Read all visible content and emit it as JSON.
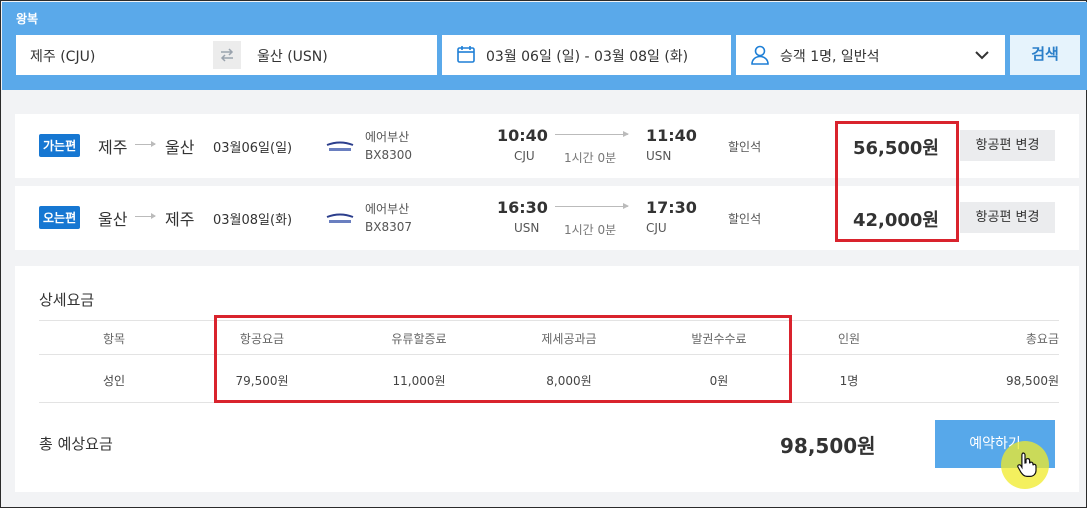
{
  "search": {
    "trip_type": "왕복",
    "from": "제주 (CJU)",
    "to": "울산 (USN)",
    "dates": "03월 06일 (일)  -  03월 08일 (화)",
    "passengers": "승객 1명, 일반석",
    "search_label": "검색"
  },
  "flights": [
    {
      "badge": "가는편",
      "from_city": "제주",
      "to_city": "울산",
      "date": "03월06일(일)",
      "airline": "에어부산",
      "flight_no": "BX8300",
      "dep_time": "10:40",
      "dep_code": "CJU",
      "duration": "1시간 0분",
      "arr_time": "11:40",
      "arr_code": "USN",
      "seat_class": "할인석",
      "fare": "56,500원",
      "change_label": "항공편 변경"
    },
    {
      "badge": "오는편",
      "from_city": "울산",
      "to_city": "제주",
      "date": "03월08일(화)",
      "airline": "에어부산",
      "flight_no": "BX8307",
      "dep_time": "16:30",
      "dep_code": "USN",
      "duration": "1시간 0분",
      "arr_time": "17:30",
      "arr_code": "CJU",
      "seat_class": "할인석",
      "fare": "42,000원",
      "change_label": "항공편 변경"
    }
  ],
  "details": {
    "title": "상세요금",
    "headers": [
      "항목",
      "항공요금",
      "유류할증료",
      "제세공과금",
      "발권수수료",
      "인원",
      "총요금"
    ],
    "rows": [
      [
        "성인",
        "79,500원",
        "11,000원",
        "8,000원",
        "0원",
        "1명",
        "98,500원"
      ]
    ],
    "total_label": "총 예상요금",
    "total_amount": "98,500원",
    "book_label": "예약하기"
  },
  "colors": {
    "header_bg": "#5aa9ea",
    "badge_bg": "#1677d2",
    "highlight": "#d9232d",
    "book_btn": "#57a8ea"
  }
}
